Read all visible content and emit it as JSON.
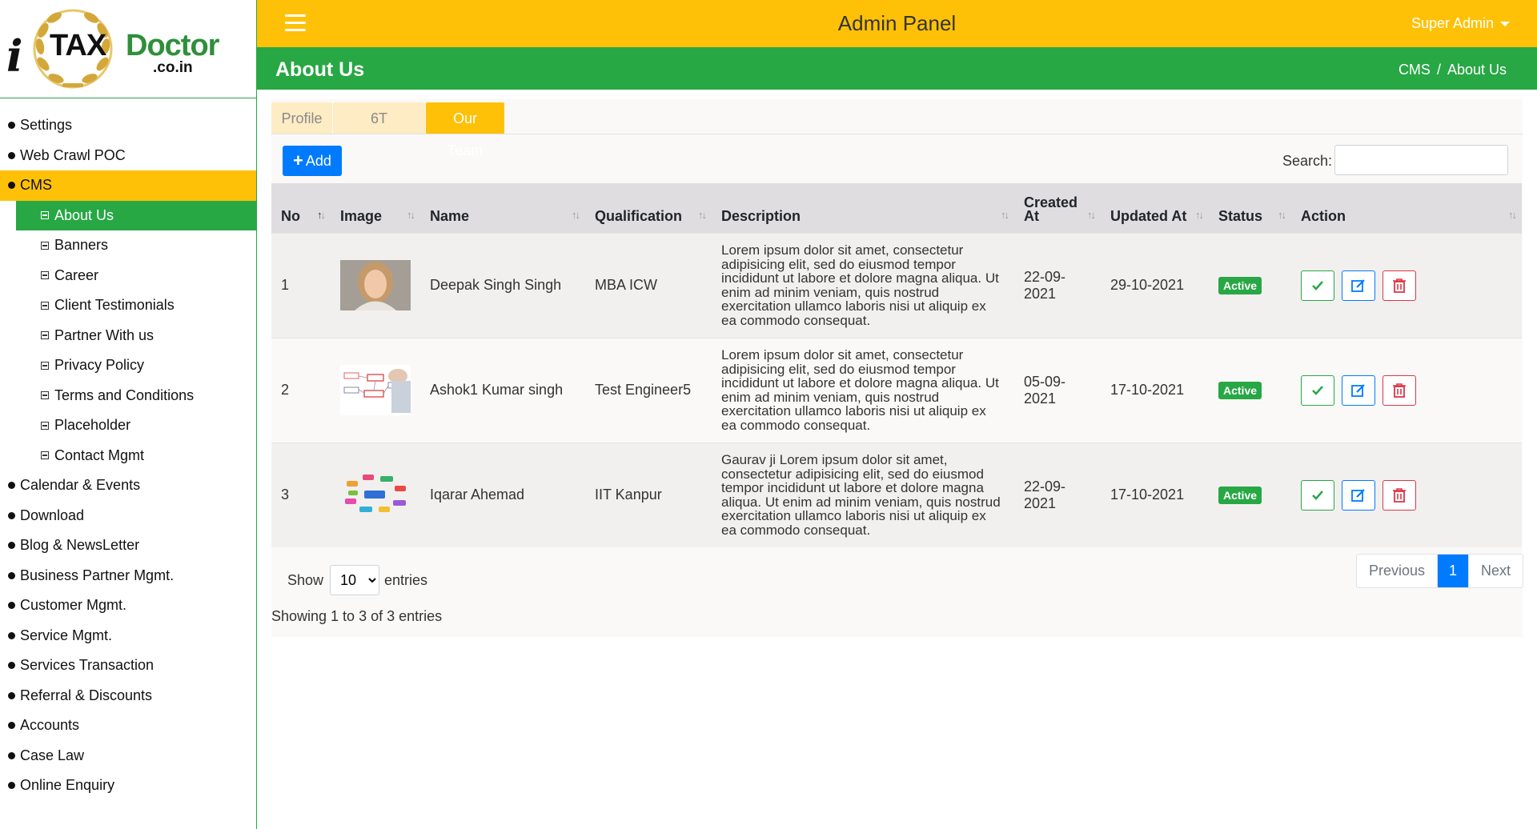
{
  "logo": {
    "i": "i",
    "tax": "TAX",
    "doctor": "Doctor",
    "domain": ".co.in"
  },
  "header": {
    "title": "Admin Panel",
    "user": "Super Admin"
  },
  "page": {
    "title": "About Us",
    "breadcrumb": [
      "CMS",
      "About Us"
    ],
    "breadcrumb_sep": "/"
  },
  "sidebar": {
    "items_before": [
      "Settings",
      "Web Crawl POC"
    ],
    "cms": "CMS",
    "cms_sub": [
      "About Us",
      "Banners",
      "Career",
      "Client Testimonials",
      "Partner With us",
      "Privacy Policy",
      "Terms and Conditions",
      "Placeholder",
      "Contact Mgmt"
    ],
    "items_after": [
      "Calendar & Events",
      "Download",
      "Blog & NewsLetter",
      "Business Partner Mgmt.",
      "Customer Mgmt.",
      "Service Mgmt.",
      "Services Transaction",
      "Referral & Discounts",
      "Accounts",
      "Case Law",
      "Online Enquiry"
    ]
  },
  "tabs": [
    "Profile",
    "6T",
    "Our Team"
  ],
  "toolbar": {
    "add_label": "Add",
    "search_label": "Search:",
    "search_value": ""
  },
  "table": {
    "columns": [
      "No",
      "Image",
      "Name",
      "Qualification",
      "Description",
      "Created At",
      "Updated At",
      "Status",
      "Action"
    ],
    "rows": [
      {
        "no": "1",
        "image": "portrait-photo",
        "name": "Deepak Singh Singh",
        "qualification": "MBA ICW",
        "description": "Lorem ipsum dolor sit amet, consectetur adipisicing elit, sed do eiusmod tempor incididunt ut labore et dolore magna aliqua. Ut enim ad minim veniam, quis nostrud exercitation ullamco laboris nisi ut aliquip ex ea commodo consequat.",
        "created": "22-09-2021",
        "updated": "29-10-2021",
        "status": "Active"
      },
      {
        "no": "2",
        "image": "flowchart-photo",
        "name": "Ashok1 Kumar singh",
        "qualification": "Test Engineer5",
        "description": "Lorem ipsum dolor sit amet, consectetur adipisicing elit, sed do eiusmod tempor incididunt ut labore et dolore magna aliqua. Ut enim ad minim veniam, quis nostrud exercitation ullamco laboris nisi ut aliquip ex ea commodo consequat.",
        "created": "05-09-2021",
        "updated": "17-10-2021",
        "status": "Active"
      },
      {
        "no": "3",
        "image": "mindmap-photo",
        "name": "Iqarar Ahemad",
        "qualification": "IIT Kanpur",
        "description": "Gaurav ji Lorem ipsum dolor sit amet, consectetur adipisicing elit, sed do eiusmod tempor incididunt ut labore et dolore magna aliqua. Ut enim ad minim veniam, quis nostrud exercitation ullamco laboris nisi ut aliquip ex ea commodo consequat.",
        "created": "22-09-2021",
        "updated": "17-10-2021",
        "status": "Active"
      }
    ]
  },
  "footer": {
    "show_label": "Show",
    "page_size": "10",
    "entries_label": "entries",
    "summary": "Showing 1 to 3 of 3 entries",
    "pagination": {
      "prev": "Previous",
      "current": "1",
      "next": "Next"
    }
  },
  "colors": {
    "header": "#ffc107",
    "pagebar": "#28a745",
    "primary": "#007bff",
    "danger": "#dc3545",
    "success": "#28a745"
  }
}
